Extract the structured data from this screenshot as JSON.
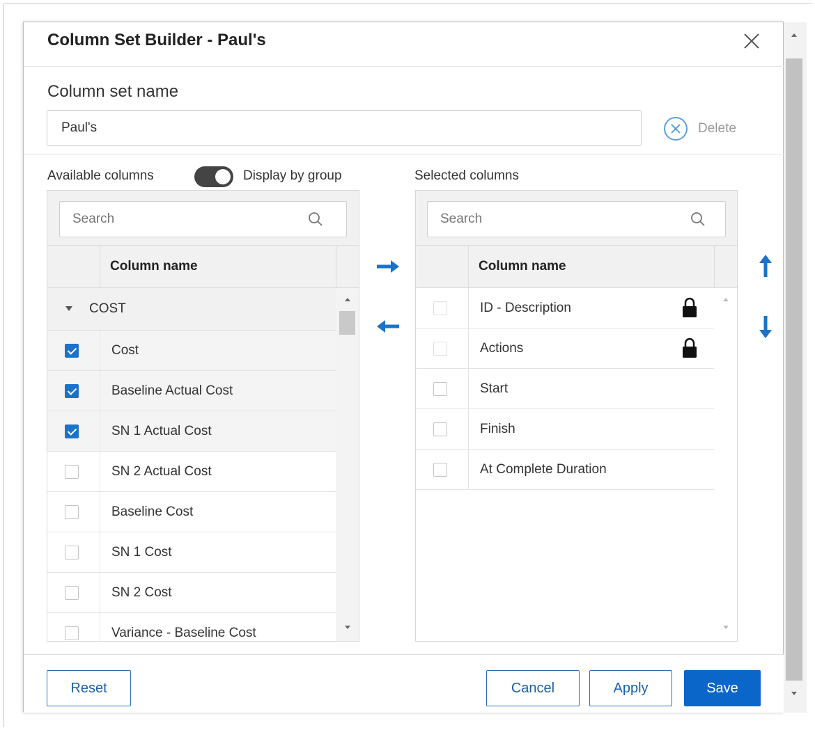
{
  "dialog": {
    "title": "Column Set Builder -  Paul's",
    "name_label": "Column set name",
    "name_value": "Paul's",
    "delete_label": "Delete"
  },
  "available": {
    "label": "Available columns",
    "toggle_label": "Display by group",
    "toggle_on": true,
    "search_placeholder": "Search",
    "column_header": "Column name",
    "group_name": "COST",
    "rows": [
      {
        "label": "Cost",
        "checked": true
      },
      {
        "label": "Baseline Actual Cost",
        "checked": true
      },
      {
        "label": "SN 1 Actual Cost",
        "checked": true
      },
      {
        "label": "SN 2 Actual Cost",
        "checked": false
      },
      {
        "label": "Baseline Cost",
        "checked": false
      },
      {
        "label": "SN 1 Cost",
        "checked": false
      },
      {
        "label": "SN 2 Cost",
        "checked": false
      },
      {
        "label": "Variance - Baseline Cost",
        "checked": false
      }
    ]
  },
  "selected": {
    "label": "Selected columns",
    "search_placeholder": "Search",
    "column_header": "Column name",
    "rows": [
      {
        "label": "ID - Description",
        "locked": true
      },
      {
        "label": "Actions",
        "locked": true
      },
      {
        "label": "Start",
        "locked": false
      },
      {
        "label": "Finish",
        "locked": false
      },
      {
        "label": "At Complete Duration",
        "locked": false
      }
    ]
  },
  "footer": {
    "reset": "Reset",
    "cancel": "Cancel",
    "apply": "Apply",
    "save": "Save"
  },
  "colors": {
    "accent": "#1a73c9",
    "primary_button": "#0a66c9",
    "toggle_on": "#444444"
  }
}
